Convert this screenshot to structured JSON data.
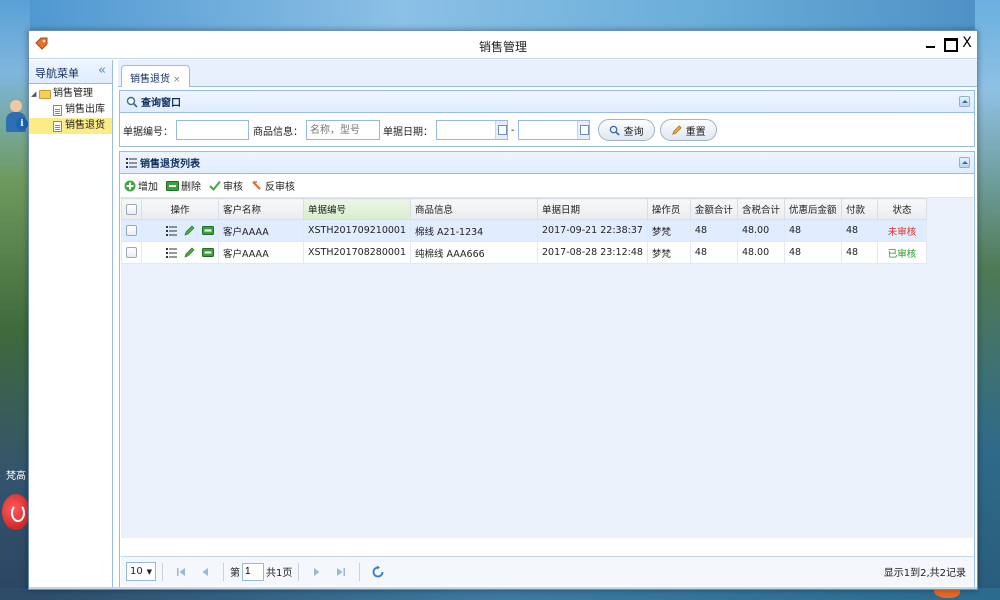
{
  "window": {
    "title": "销售管理"
  },
  "desktop": {
    "user_name": "梵高"
  },
  "sidebar": {
    "title": "导航菜单",
    "tree": {
      "root": "销售管理",
      "children": [
        "销售出库",
        "销售退货"
      ],
      "selected": "销售退货"
    }
  },
  "tabs": [
    {
      "label": "销售退货",
      "close": "×"
    }
  ],
  "query": {
    "title": "查询窗口",
    "bill_no_label": "单据编号：",
    "bill_no_value": "",
    "product_label": "商品信息：",
    "product_placeholder": "名称，型号",
    "date_label": "单据日期：",
    "date_sep": "-",
    "search_button": "查询",
    "reset_button": "重置"
  },
  "list": {
    "title": "销售退货列表",
    "toolbar": {
      "add": "增加",
      "delete": "删除",
      "audit": "审核",
      "unaudit": "反审核"
    },
    "columns": [
      "操作",
      "客户名称",
      "单据编号",
      "商品信息",
      "单据日期",
      "操作员",
      "金额合计",
      "含税合计",
      "优惠后金额",
      "付款",
      "状态"
    ],
    "rows": [
      {
        "customer": "客户AAAA",
        "bill_no": "XSTH201709210001",
        "product": "棉线 A21-1234",
        "date": "2017-09-21 22:38:37",
        "operator": "梦梵",
        "amount": "48",
        "tax_total": "48.00",
        "discounted": "48",
        "paid": "48",
        "status": "未审核",
        "status_color": "#e0322a"
      },
      {
        "customer": "客户AAAA",
        "bill_no": "XSTH201708280001",
        "product": "纯棉线 AAA666",
        "date": "2017-08-28 23:12:48",
        "operator": "梦梵",
        "amount": "48",
        "tax_total": "48.00",
        "discounted": "48",
        "paid": "48",
        "status": "已审核",
        "status_color": "#2a9a2a"
      }
    ],
    "pager": {
      "page_size": "10",
      "page_prefix": "第",
      "page_value": "1",
      "page_suffix": "共1页",
      "info": "显示1到2,共2记录"
    }
  },
  "colors": {
    "accent": "#99bbe8",
    "header_bg": "#e0ecff",
    "selected_tree": "#fbec88"
  }
}
